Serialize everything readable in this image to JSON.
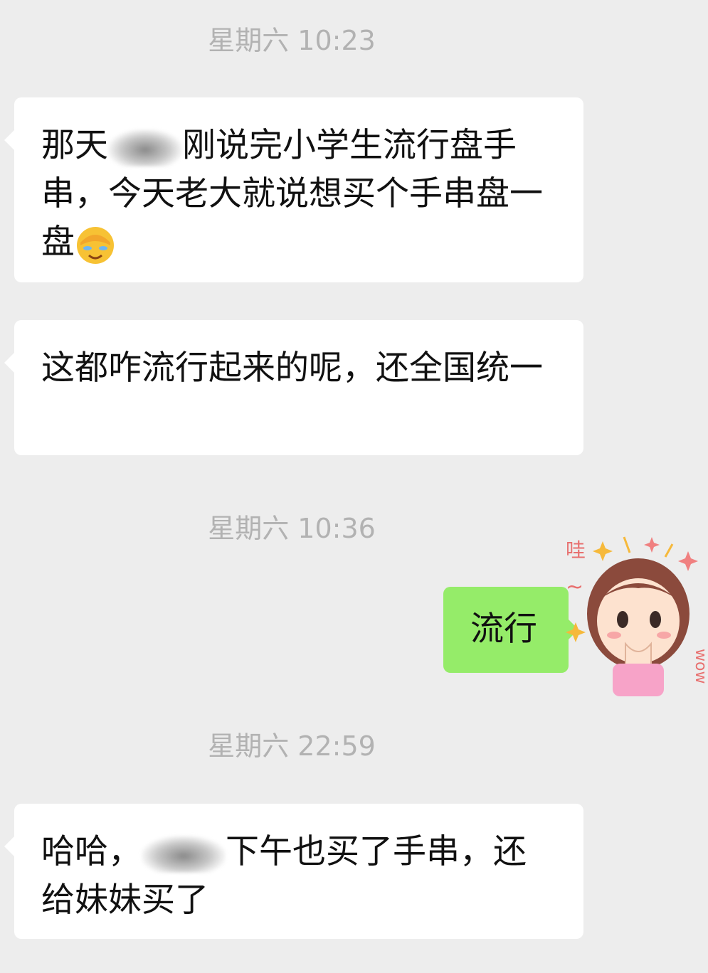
{
  "timestamps": [
    "星期六 10:23",
    "星期六 10:36",
    "星期六 22:59"
  ],
  "messages": {
    "m1": {
      "part1": "那天",
      "part2": "刚说完小学生流行盘手串，今天老大就说想买个手串盘一盘",
      "emoji": "face-palm-crying-emoji"
    },
    "m2": {
      "text": "这都咋流行起来的呢，还全国统一"
    },
    "m3": {
      "text": "流行"
    },
    "m4": {
      "part1": "哈哈，",
      "part2": "下午也买了手串，还给妹妹买了"
    }
  },
  "sticker": {
    "name": "girl-wow-sticker",
    "text_top": "哇",
    "text_tilde": "~",
    "text_side": "wow"
  },
  "colors": {
    "background": "#ededed",
    "incoming_bubble": "#ffffff",
    "outgoing_bubble": "#95ec69",
    "timestamp": "#b2b2b2"
  }
}
